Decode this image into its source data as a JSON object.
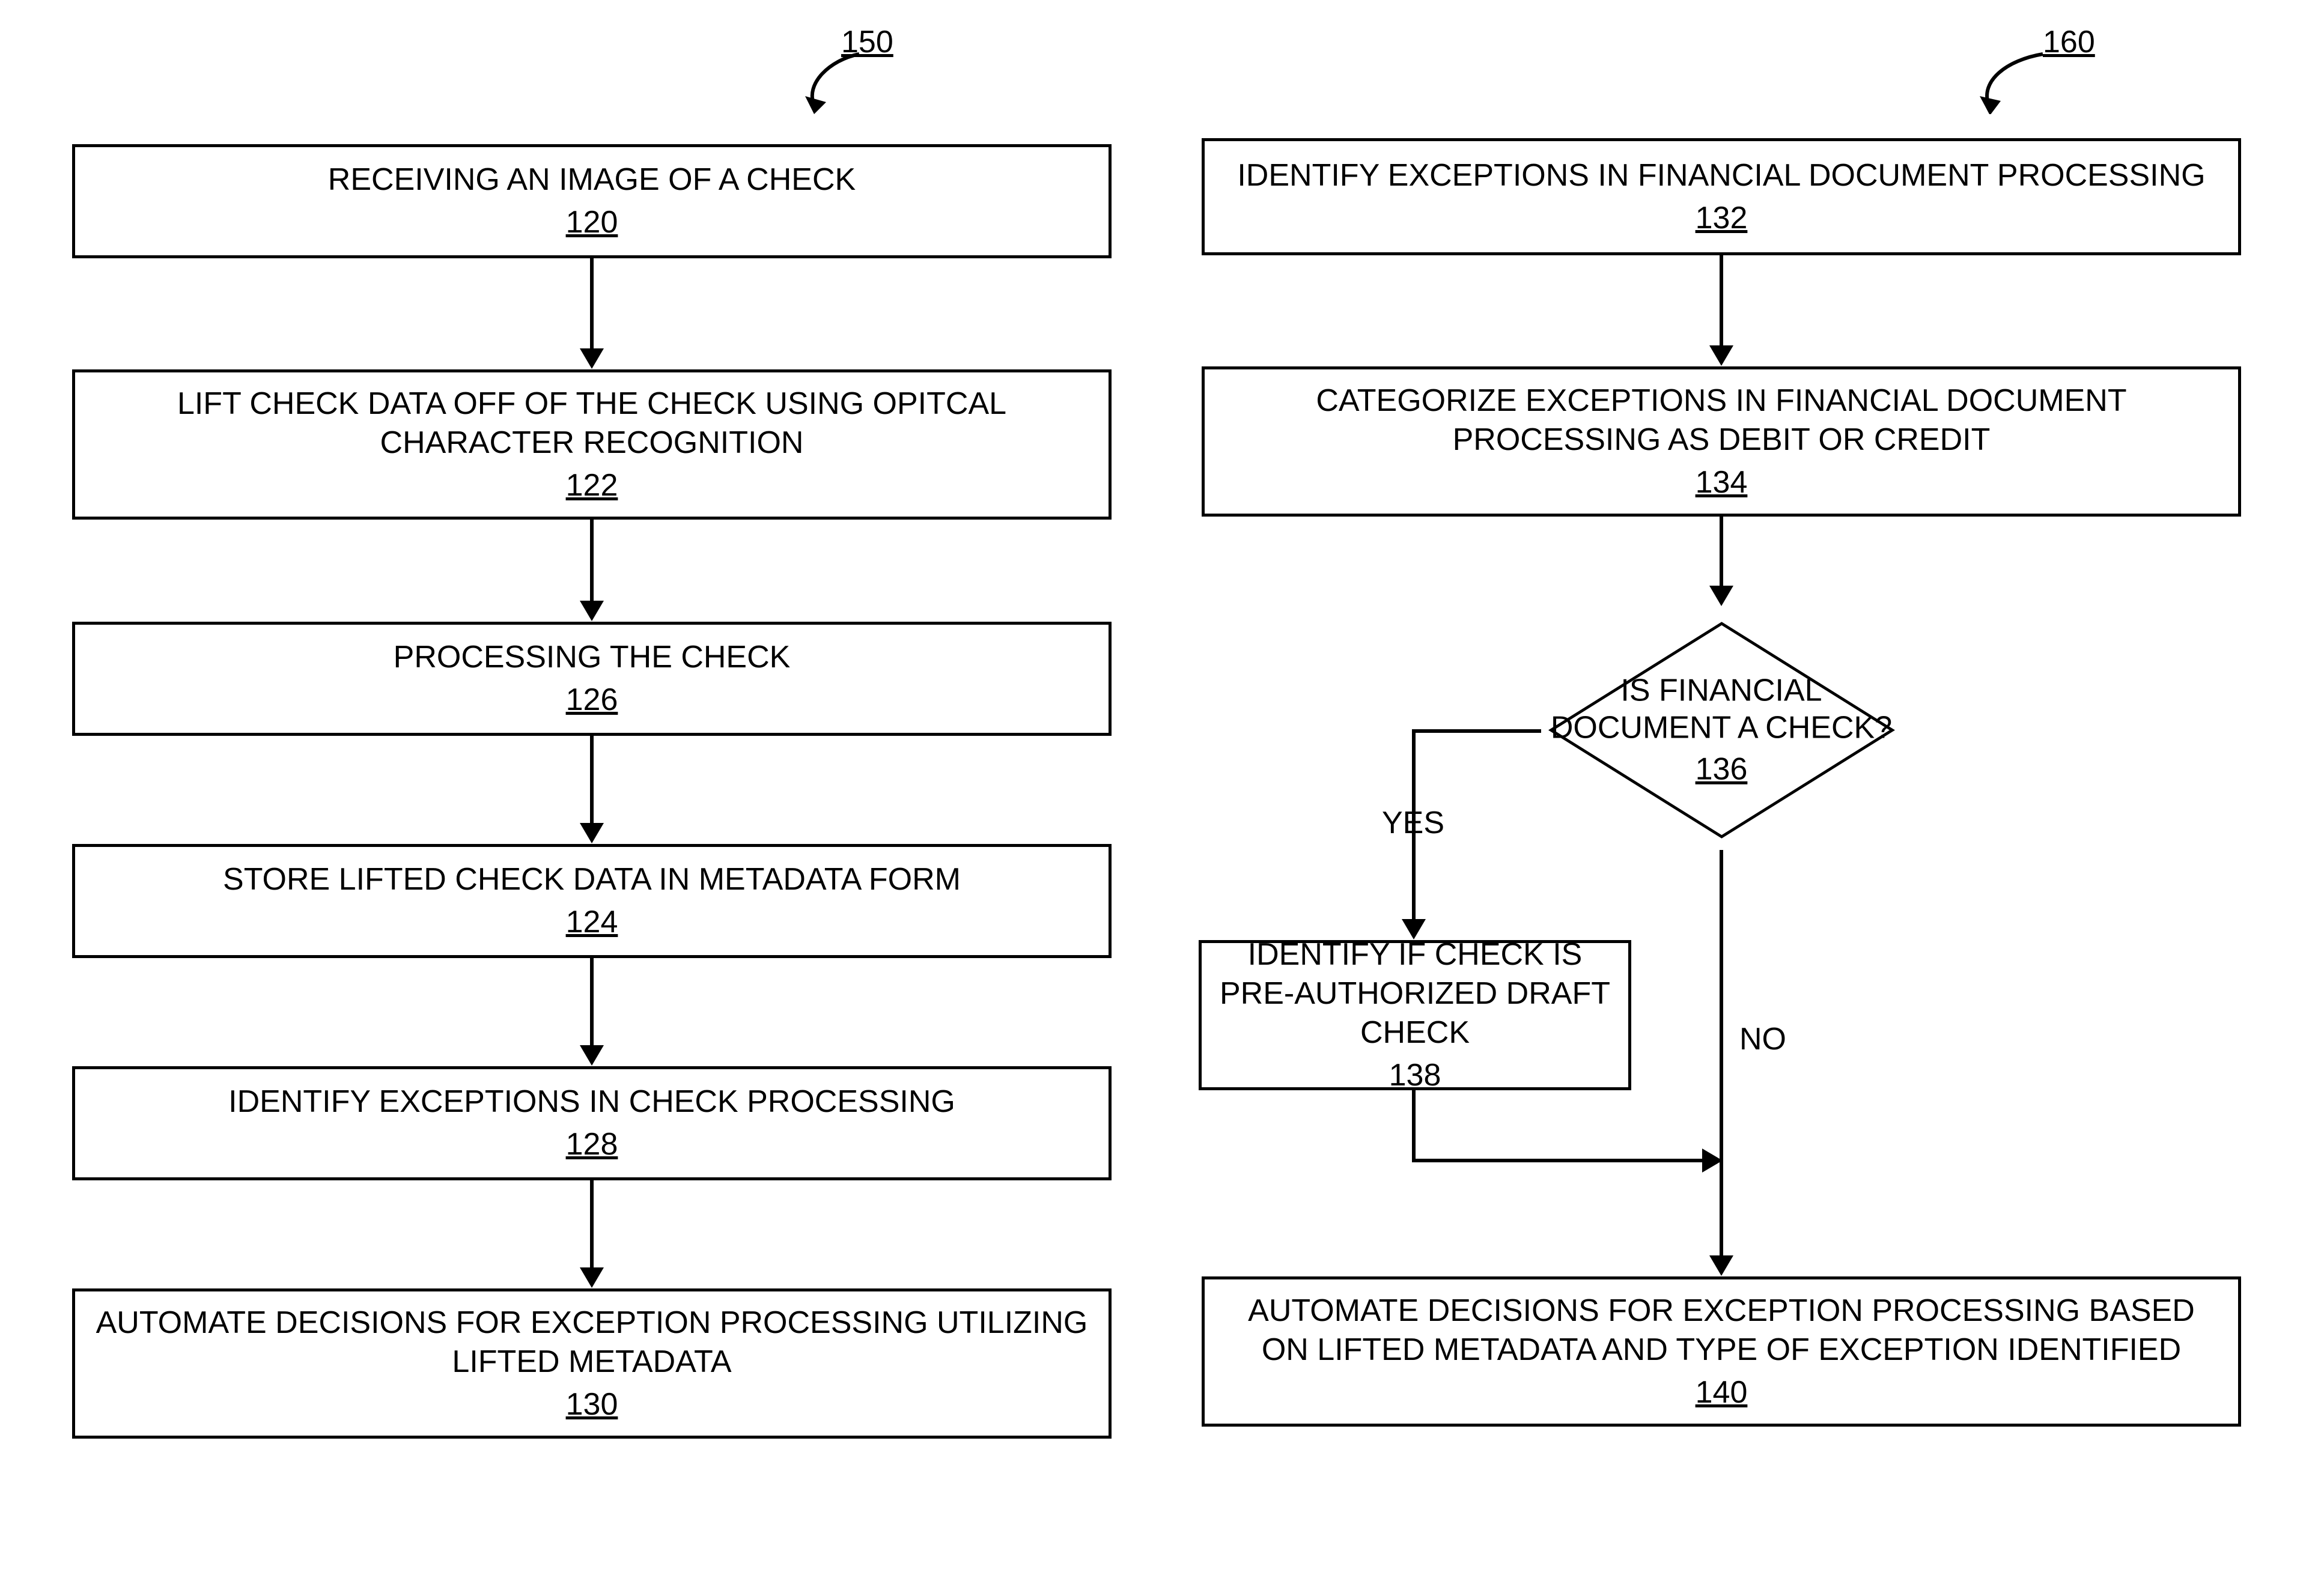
{
  "left": {
    "fig_ref": "150",
    "boxes": {
      "b120": {
        "label": "RECEIVING AN IMAGE OF A CHECK",
        "ref": "120"
      },
      "b122": {
        "label": "LIFT CHECK DATA OFF OF THE CHECK USING OPITCAL CHARACTER RECOGNITION",
        "ref": "122"
      },
      "b126": {
        "label": "PROCESSING THE CHECK",
        "ref": "126"
      },
      "b124": {
        "label": "STORE LIFTED CHECK DATA IN METADATA FORM",
        "ref": "124"
      },
      "b128": {
        "label": "IDENTIFY EXCEPTIONS IN CHECK PROCESSING",
        "ref": "128"
      },
      "b130": {
        "label": "AUTOMATE DECISIONS FOR EXCEPTION PROCESSING UTILIZING LIFTED METADATA",
        "ref": "130"
      }
    }
  },
  "right": {
    "fig_ref": "160",
    "boxes": {
      "b132": {
        "label": "IDENTIFY EXCEPTIONS IN FINANCIAL DOCUMENT PROCESSING",
        "ref": "132"
      },
      "b134": {
        "label": "CATEGORIZE EXCEPTIONS IN FINANCIAL DOCUMENT PROCESSING AS DEBIT OR CREDIT",
        "ref": "134"
      },
      "b138": {
        "label": "IDENTIFY IF CHECK IS PRE-AUTHORIZED DRAFT CHECK",
        "ref": "138"
      },
      "b140": {
        "label": "AUTOMATE DECISIONS FOR EXCEPTION PROCESSING BASED ON LIFTED METADATA AND TYPE OF EXCEPTION IDENTIFIED",
        "ref": "140"
      }
    },
    "decision": {
      "d136_line1": "IS FINANCIAL",
      "d136_line2": "DOCUMENT A CHECK?",
      "d136_ref": "136"
    },
    "labels": {
      "yes": "YES",
      "no": "NO"
    }
  }
}
